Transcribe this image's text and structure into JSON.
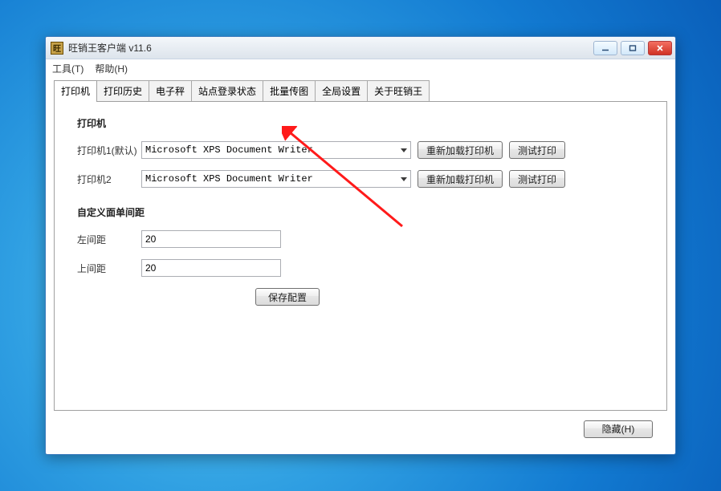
{
  "window": {
    "title": "旺销王客户端 v11.6",
    "controls": {
      "minimize": "–",
      "maximize": "□",
      "close": "×"
    }
  },
  "menubar": {
    "tools": "工具(T)",
    "help": "帮助(H)"
  },
  "tabs": [
    {
      "label": "打印机",
      "active": true
    },
    {
      "label": "打印历史"
    },
    {
      "label": "电子秤"
    },
    {
      "label": "站点登录状态"
    },
    {
      "label": "批量传图"
    },
    {
      "label": "全局设置"
    },
    {
      "label": "关于旺销王"
    }
  ],
  "printer": {
    "section_title": "打印机",
    "printer1_label": "打印机1(默认)",
    "printer1_value": "Microsoft XPS Document Writer",
    "printer2_label": "打印机2",
    "printer2_value": "Microsoft XPS Document Writer",
    "reload_label": "重新加载打印机",
    "test_print_label": "测试打印"
  },
  "margin": {
    "section_title": "自定义面单间距",
    "left_label": "左间距",
    "left_value": "20",
    "top_label": "上间距",
    "top_value": "20"
  },
  "save_button": "保存配置",
  "hide_button": "隐藏(H)"
}
